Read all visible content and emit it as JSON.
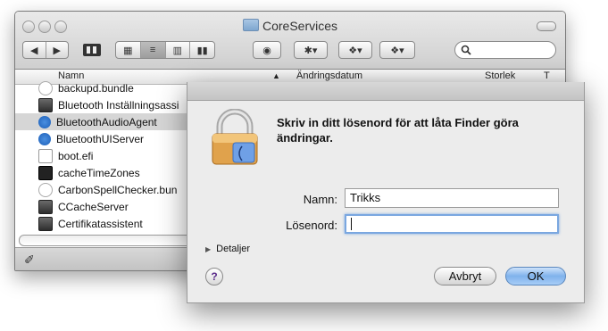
{
  "window": {
    "title": "CoreServices"
  },
  "toolbar": {
    "nav_back": "◀",
    "nav_forward": "▶",
    "action_menu": "✱▾",
    "dropbox_a": "❖▾",
    "dropbox_b": "❖▾",
    "eye": "◉"
  },
  "columns": {
    "name": "Namn",
    "date": "Ändringsdatum",
    "size": "Storlek",
    "kind": "T"
  },
  "files": [
    {
      "label": "backupd.bundle",
      "icon": "bundle-icon"
    },
    {
      "label": "Bluetooth Inställningsassi",
      "icon": "app-icon"
    },
    {
      "label": "BluetoothAudioAgent",
      "icon": "bluetooth-icon"
    },
    {
      "label": "BluetoothUIServer",
      "icon": "bluetooth-icon"
    },
    {
      "label": "boot.efi",
      "icon": "file-icon"
    },
    {
      "label": "cacheTimeZones",
      "icon": "terminal-icon"
    },
    {
      "label": "CarbonSpellChecker.bun",
      "icon": "bundle-icon"
    },
    {
      "label": "CCacheServer",
      "icon": "app-icon"
    },
    {
      "label": "Certifikatassistent",
      "icon": "app-icon"
    }
  ],
  "selected_index": 2,
  "dialog": {
    "message": "Skriv in ditt lösenord för att låta Finder göra ändringar.",
    "name_label": "Namn:",
    "name_value": "Trikks",
    "password_label": "Lösenord:",
    "password_value": "",
    "details_label": "Detaljer",
    "help_label": "?",
    "cancel_label": "Avbryt",
    "ok_label": "OK"
  }
}
